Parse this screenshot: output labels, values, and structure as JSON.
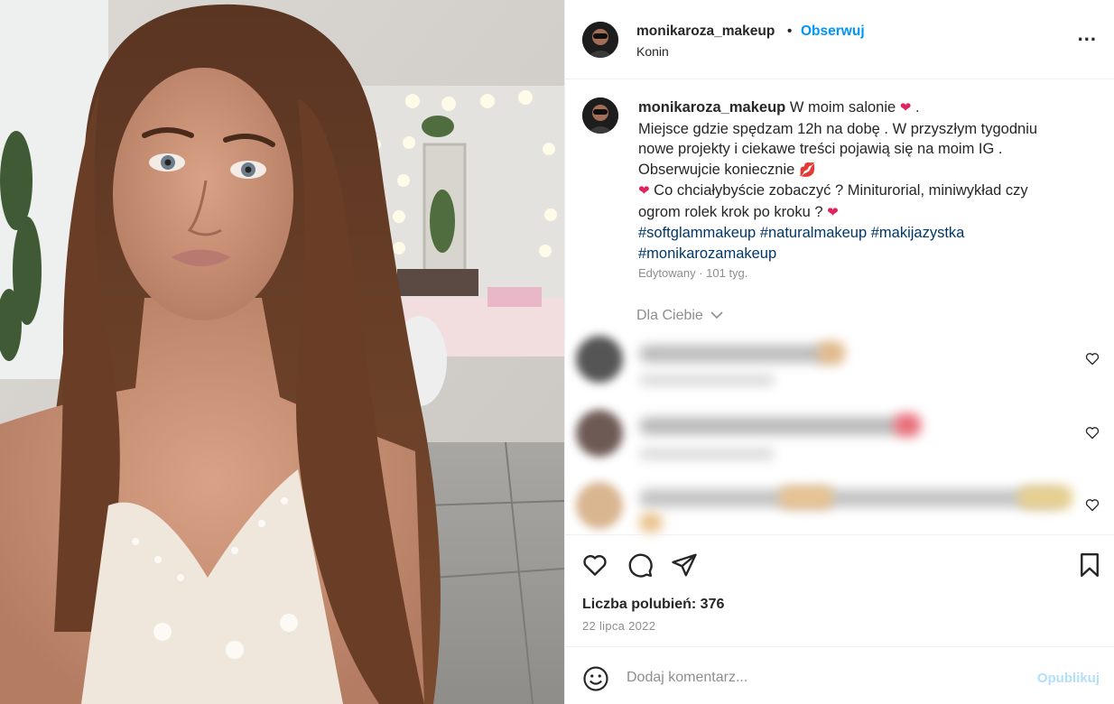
{
  "post": {
    "username": "monikaroza_makeup",
    "dot": "•",
    "follow_label": "Obserwuj",
    "location": "Konin",
    "more_label": "..."
  },
  "caption": {
    "username": "monikaroza_makeup",
    "line1": "W moim salonie",
    "line1_end": ".",
    "line2": "Miejsce gdzie spędzam 12h na dobę . W przyszłym tygodniu nowe projekty i ciekawe treści pojawią się na moim IG .",
    "line3": "Obserwujcie koniecznie",
    "line4": "Co chciałybyście zobaczyć ? Miniturorial, miniwykład czy ogrom rolek krok po kroku ?",
    "tags": "#softglammakeup #naturalmakeup #makijazystka #monikarozamakeup",
    "meta": "Edytowany · 101 tyg.",
    "emoji_heart": "❤",
    "emoji_lips": "💋"
  },
  "comments": {
    "filter_label": "Dla Ciebie",
    "chevron": "⌄",
    "like_glyph": "♡"
  },
  "actions": {
    "likes": "Liczba polubień: 376",
    "date": "22 lipca 2022"
  },
  "add_comment": {
    "placeholder": "Dodaj komentarz...",
    "publish_label": "Opublikuj"
  },
  "colors": {
    "follow": "#0095f6",
    "hashtag": "#00376b",
    "muted": "#8e8e8e",
    "publish_disabled": "#b2dffc"
  },
  "icons": [
    "heart-icon",
    "comment-icon",
    "share-icon",
    "bookmark-icon",
    "emoji-icon",
    "more-icon"
  ]
}
